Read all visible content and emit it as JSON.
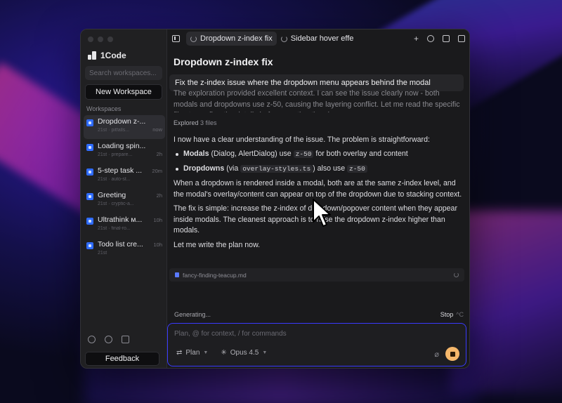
{
  "app": {
    "name": "1Code"
  },
  "sidebar": {
    "search_placeholder": "Search workspaces...",
    "new_workspace_label": "New Workspace",
    "section_label": "Workspaces",
    "items": [
      {
        "title": "Dropdown z-...",
        "subtitle": "21st · pitfalls...",
        "time": "now",
        "active": true
      },
      {
        "title": "Loading spin...",
        "subtitle": "21st · prepare...",
        "time": "2h",
        "active": false
      },
      {
        "title": "5-step task ...",
        "subtitle": "21st · auto-st...",
        "time": "20m",
        "active": false
      },
      {
        "title": "Greeting",
        "subtitle": "21st · cryptic-a...",
        "time": "2h",
        "active": false
      },
      {
        "title": "Ultrathink м...",
        "subtitle": "21st · final-ro...",
        "time": "10h",
        "active": false
      },
      {
        "title": "Todo list cre...",
        "subtitle": "21st",
        "time": "10h",
        "active": false
      }
    ],
    "feedback_label": "Feedback"
  },
  "tabs": [
    {
      "label": "Dropdown z-index fix",
      "active": true
    },
    {
      "label": "Sidebar hover effe",
      "active": false
    }
  ],
  "chat": {
    "title": "Dropdown z-index fix",
    "user_prompt": "Fix the z-index issue where the dropdown menu appears behind the modal",
    "faded_text": "The exploration provided excellent context. I can see the issue clearly now - both modals and dropdowns use z-50, causing the layering conflict. Let me read the specific files to confirm the details before creating the plan.",
    "explored_label": "Explored",
    "explored_count": "3 files",
    "understanding": "I now have a clear understanding of the issue. The problem is straightforward:",
    "bullet1_bold": "Modals",
    "bullet1_rest": " (Dialog, AlertDialog) use ",
    "bullet1_code": "z-50",
    "bullet1_end": " for both overlay and content",
    "bullet2_bold": "Dropdowns",
    "bullet2_rest": " (via ",
    "bullet2_code": "overlay-styles.ts",
    "bullet2_mid": ") also use ",
    "bullet2_code2": "z-50",
    "para1": "When a dropdown is rendered inside a modal, both are at the same z-index level, and the modal's overlay/content can appear on top of the dropdown due to stacking context.",
    "para2": "The fix is simple: increase the z-index of dropdown/popover content when they appear inside modals. The cleanest approach is to raise the dropdown z-index higher than modals.",
    "para3": "Let me write the plan now.",
    "file_name": "fancy-finding-teacup.md"
  },
  "status": {
    "generating_label": "Generating...",
    "stop_label": "Stop",
    "stop_shortcut": "^C"
  },
  "composer": {
    "placeholder": "Plan, @ for context, / for commands",
    "mode_label": "Plan",
    "model_label": "Opus 4.5"
  },
  "colors": {
    "accent": "#3a3aff",
    "stop_button": "#f5b76b",
    "workspace_icon": "#2f6cff"
  }
}
